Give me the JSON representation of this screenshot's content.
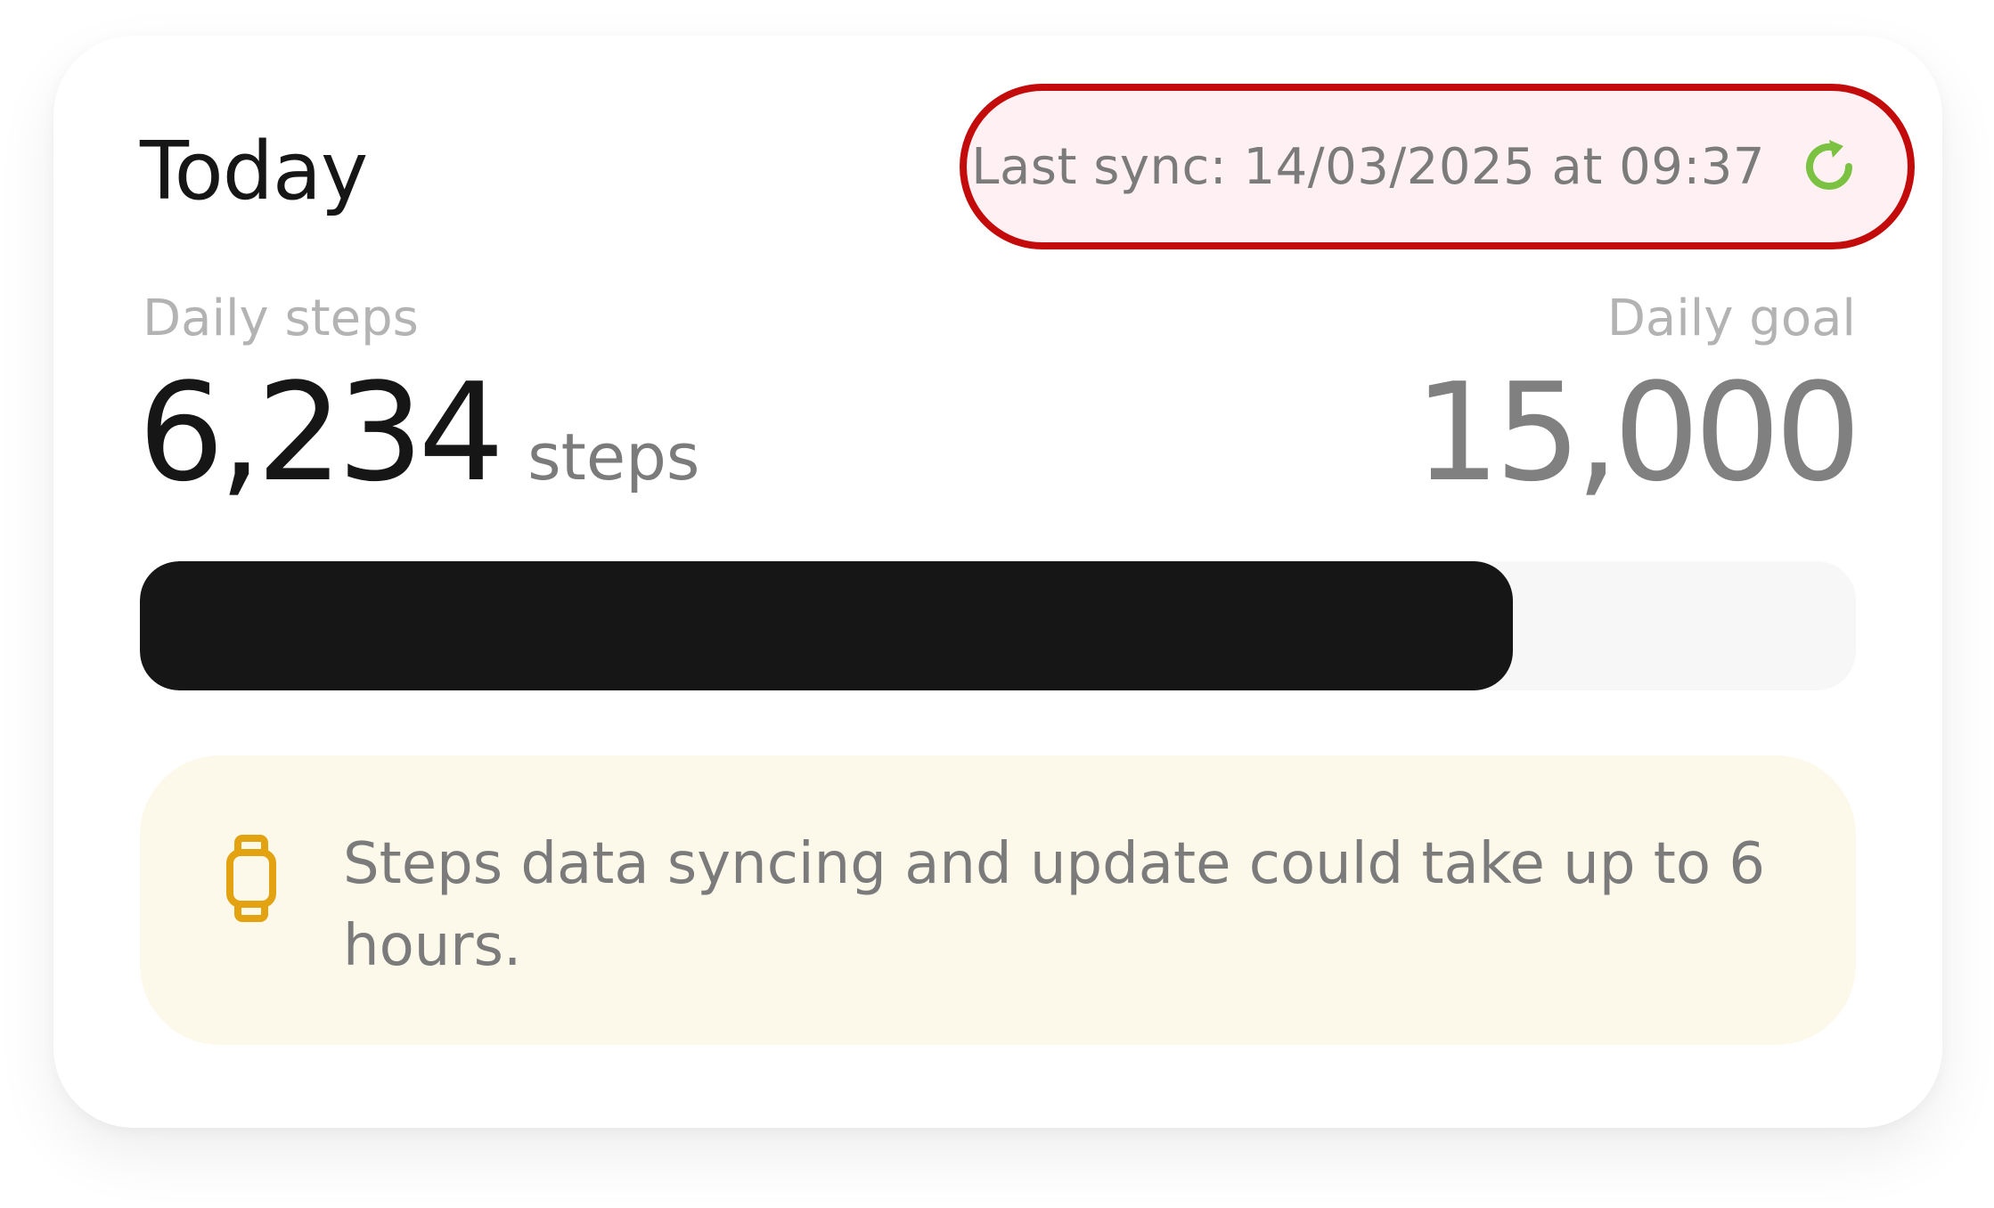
{
  "card": {
    "title": "Today"
  },
  "sync": {
    "text": "Last sync: 14/03/2025 at 09:37",
    "icon": "refresh-icon",
    "icon_color": "#7cc242",
    "highlight_color": "#c40b0b"
  },
  "steps": {
    "label": "Daily steps",
    "value": "6,234",
    "unit": "steps"
  },
  "goal": {
    "label": "Daily goal",
    "value": "15,000"
  },
  "progress": {
    "fraction": 0.8,
    "fill_color": "#161616"
  },
  "notice": {
    "icon": "smartwatch-icon",
    "icon_color": "#e3a20f",
    "text": "Steps data syncing and update could take up to 6 hours."
  }
}
